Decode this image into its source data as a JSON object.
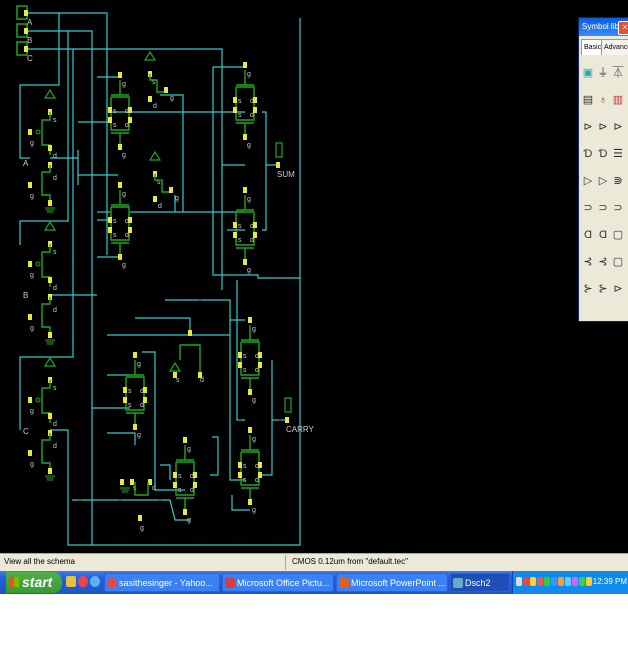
{
  "schematic": {
    "inputs": [
      "A",
      "B",
      "C"
    ],
    "inverter_labels": [
      "A",
      "B",
      "C"
    ],
    "outputs": [
      "SUM",
      "CARRY"
    ],
    "pin_labels": {
      "source": "s",
      "drain": "d",
      "gate": "g"
    },
    "colors": {
      "background": "#000000",
      "wire": "#33cccc",
      "transistor": "#1fa81f",
      "pin": "#e8e83a",
      "label": "#cccccc"
    }
  },
  "symbol_library": {
    "title": "Symbol libr...",
    "tabs": [
      "Basic",
      "Advanced"
    ],
    "active_tab": "Basic",
    "icons": [
      "button",
      "ground",
      "vdd",
      "keyboard",
      "led",
      "display",
      "nmos",
      "pmos",
      "inverter",
      "and",
      "nand",
      "register",
      "or",
      "nor",
      "xor",
      "and3",
      "nand3",
      "xor3",
      "or3",
      "nor3",
      "counter",
      "switch",
      "switch2",
      "mux",
      "buffer",
      "tristate",
      "amplifier"
    ]
  },
  "status_bar": {
    "hint": "View all the schema",
    "technology": "CMOS 0.12um from \"default.tec\""
  },
  "taskbar": {
    "start": "start",
    "tasks": [
      "sasithesinger - Yahoo...",
      "Microsoft Office Pictu...",
      "Microsoft PowerPoint ...",
      "Dsch2"
    ],
    "active_task": "Dsch2",
    "clock": "12:39 PM"
  }
}
